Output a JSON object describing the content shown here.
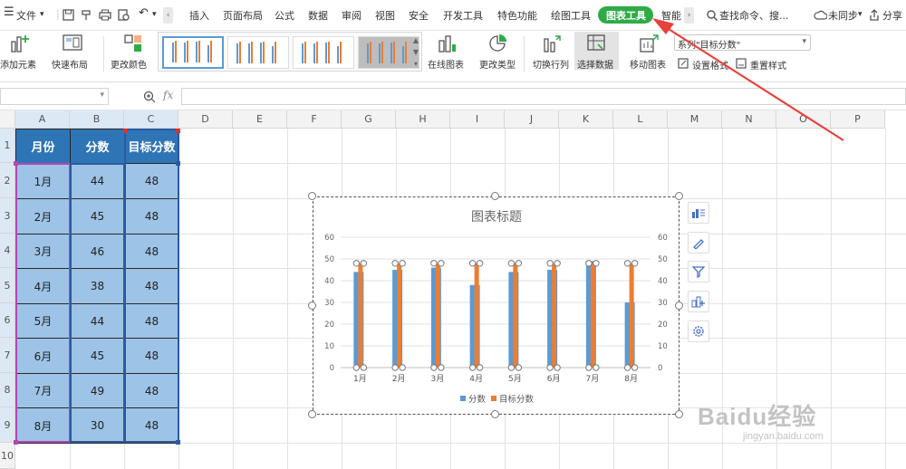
{
  "menu": {
    "file": "文件",
    "tabs": [
      "插入",
      "页面布局",
      "公式",
      "数据",
      "审阅",
      "视图",
      "安全",
      "开发工具",
      "特色功能",
      "绘图工具",
      "图表工具",
      "智能"
    ],
    "active_tab": "图表工具",
    "search": "查找命令、搜...",
    "sync": "未同步",
    "share": "分享"
  },
  "ribbon": {
    "add_element": "添加元素",
    "quick_layout": "快速布局",
    "change_color": "更改颜色",
    "online_chart": "在线图表",
    "change_type": "更改类型",
    "switch_row_col": "切换行列",
    "select_data": "选择数据",
    "move_chart": "移动图表",
    "series_select": "系列\"目标分数\"",
    "set_format": "设置格式",
    "reset_style": "重置样式"
  },
  "formula": {
    "fx": "fx"
  },
  "columns": [
    "A",
    "B",
    "C",
    "D",
    "E",
    "F",
    "G",
    "H",
    "I",
    "J",
    "K",
    "L",
    "M",
    "N",
    "O",
    "P"
  ],
  "rows": [
    "1",
    "2",
    "3",
    "4",
    "5",
    "6",
    "7",
    "8",
    "9",
    "10"
  ],
  "table": {
    "headers": [
      "月份",
      "分数",
      "目标分数"
    ],
    "rows": [
      [
        "1月",
        "44",
        "48"
      ],
      [
        "2月",
        "45",
        "48"
      ],
      [
        "3月",
        "46",
        "48"
      ],
      [
        "4月",
        "38",
        "48"
      ],
      [
        "5月",
        "44",
        "48"
      ],
      [
        "6月",
        "45",
        "48"
      ],
      [
        "7月",
        "49",
        "48"
      ],
      [
        "8月",
        "30",
        "48"
      ]
    ]
  },
  "chart_data": {
    "type": "bar",
    "title": "图表标题",
    "categories": [
      "1月",
      "2月",
      "3月",
      "4月",
      "5月",
      "6月",
      "7月",
      "8月"
    ],
    "series": [
      {
        "name": "分数",
        "values": [
          44,
          45,
          46,
          38,
          44,
          45,
          49,
          30
        ],
        "color": "#5b9bd5"
      },
      {
        "name": "目标分数",
        "values": [
          48,
          48,
          48,
          48,
          48,
          48,
          48,
          48
        ],
        "color": "#ed7d31"
      }
    ],
    "ylim": [
      0,
      60
    ],
    "yticks": [
      "0",
      "10",
      "20",
      "30",
      "40",
      "50",
      "60"
    ],
    "y2ticks": [
      "0",
      "10",
      "20",
      "30",
      "40",
      "50",
      "60"
    ],
    "legend": "bottom",
    "grid": true
  },
  "colors": {
    "accent_green": "#2eab45",
    "table_header": "#2e75b6",
    "table_cell": "#9dc3e6",
    "arrow": "#e8413c"
  },
  "watermark": {
    "brand": "Baidu经验",
    "url": "jingyan.baidu.com"
  }
}
